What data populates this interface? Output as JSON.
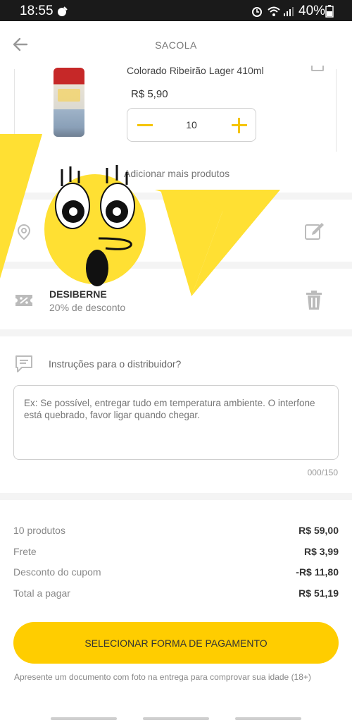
{
  "status_bar": {
    "time": "18:55",
    "battery": "40%"
  },
  "header": {
    "title": "SACOLA"
  },
  "cart_item": {
    "name": "Colorado Ribeirão Lager 410ml",
    "price": "R$ 5,90",
    "quantity": "10",
    "add_more": "Adicionar mais produtos"
  },
  "coupon": {
    "code": "DESIBERNE",
    "description": "20% de desconto"
  },
  "instructions": {
    "label": "Instruções para o distribuidor?",
    "placeholder": "Ex: Se possível, entregar tudo em temperatura ambiente. O interfone está quebrado, favor ligar quando chegar.",
    "counter": "000/150"
  },
  "summary": {
    "rows": [
      {
        "label": "10 produtos",
        "value": "R$ 59,00"
      },
      {
        "label": "Frete",
        "value": "R$ 3,99"
      },
      {
        "label": "Desconto do cupom",
        "value": "-R$ 11,80"
      },
      {
        "label": "Total a pagar",
        "value": "R$ 51,19"
      }
    ]
  },
  "cta": {
    "label": "SELECIONAR FORMA DE PAGAMENTO"
  },
  "disclaimer": "Apresente um documento com foto na entrega para comprovar sua idade (18+)",
  "colors": {
    "accent": "#ffcd00",
    "background": "#f4f4f4"
  },
  "icons": [
    "back-arrow-icon",
    "location-pin-icon",
    "edit-icon",
    "coupon-icon",
    "trash-icon",
    "chat-icon"
  ]
}
